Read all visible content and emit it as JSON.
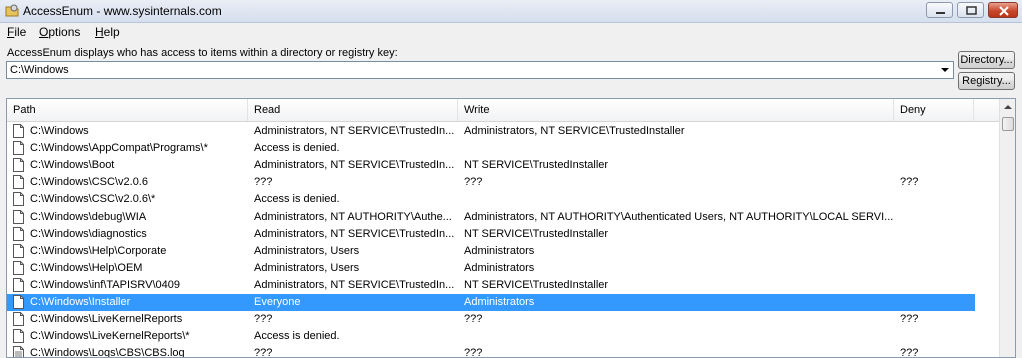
{
  "window": {
    "title": "AccessEnum - www.sysinternals.com"
  },
  "menu": [
    {
      "label": "File",
      "accel": "F",
      "rest": "ile"
    },
    {
      "label": "Options",
      "accel": "O",
      "rest": "ptions"
    },
    {
      "label": "Help",
      "accel": "H",
      "rest": "elp"
    }
  ],
  "description": "AccessEnum displays who has access to items within a directory or registry key:",
  "path_combo": {
    "value": "C:\\Windows"
  },
  "buttons": {
    "directory": "Directory...",
    "registry": "Registry..."
  },
  "columns": {
    "path": "Path",
    "read": "Read",
    "write": "Write",
    "deny": "Deny"
  },
  "rows": [
    {
      "path": "C:\\Windows",
      "read": "Administrators, NT SERVICE\\TrustedIn...",
      "write": "Administrators, NT SERVICE\\TrustedInstaller",
      "deny": "",
      "icon": "file-icon"
    },
    {
      "path": "C:\\Windows\\AppCompat\\Programs\\*",
      "read": "Access is denied.",
      "write": "",
      "deny": "",
      "icon": "file-icon"
    },
    {
      "path": "C:\\Windows\\Boot",
      "read": "Administrators, NT SERVICE\\TrustedIn...",
      "write": "NT SERVICE\\TrustedInstaller",
      "deny": "",
      "icon": "file-icon"
    },
    {
      "path": "C:\\Windows\\CSC\\v2.0.6",
      "read": "???",
      "write": "???",
      "deny": "???",
      "icon": "file-icon"
    },
    {
      "path": "C:\\Windows\\CSC\\v2.0.6\\*",
      "read": "Access is denied.",
      "write": "",
      "deny": "",
      "icon": "file-icon"
    },
    {
      "path": "C:\\Windows\\debug\\WIA",
      "read": "Administrators, NT AUTHORITY\\Authe...",
      "write": "Administrators, NT AUTHORITY\\Authenticated Users, NT AUTHORITY\\LOCAL SERVI...",
      "deny": "",
      "icon": "file-icon"
    },
    {
      "path": "C:\\Windows\\diagnostics",
      "read": "Administrators, NT SERVICE\\TrustedIn...",
      "write": "NT SERVICE\\TrustedInstaller",
      "deny": "",
      "icon": "file-icon"
    },
    {
      "path": "C:\\Windows\\Help\\Corporate",
      "read": "Administrators, Users",
      "write": "Administrators",
      "deny": "",
      "icon": "file-icon"
    },
    {
      "path": "C:\\Windows\\Help\\OEM",
      "read": "Administrators, Users",
      "write": "Administrators",
      "deny": "",
      "icon": "file-icon"
    },
    {
      "path": "C:\\Windows\\inf\\TAPISRV\\0409",
      "read": "Administrators, NT SERVICE\\TrustedIn...",
      "write": "NT SERVICE\\TrustedInstaller",
      "deny": "",
      "icon": "file-icon"
    },
    {
      "path": "C:\\Windows\\Installer",
      "read": "Everyone",
      "write": "Administrators",
      "deny": "",
      "icon": "file-icon",
      "selected": true
    },
    {
      "path": "C:\\Windows\\LiveKernelReports",
      "read": "???",
      "write": "???",
      "deny": "???",
      "icon": "file-icon"
    },
    {
      "path": "C:\\Windows\\LiveKernelReports\\*",
      "read": "Access is denied.",
      "write": "",
      "deny": "",
      "icon": "file-icon"
    },
    {
      "path": "C:\\Windows\\Logs\\CBS\\CBS.log",
      "read": "???",
      "write": "???",
      "deny": "???",
      "icon": "log-file-icon"
    }
  ],
  "colors": {
    "selection": "#3399ff"
  }
}
